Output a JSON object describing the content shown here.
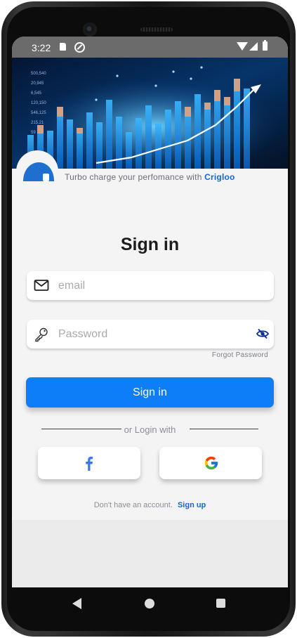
{
  "status_bar": {
    "time": "3:22",
    "icons": [
      "sd-card-icon",
      "do-not-disturb-icon",
      "wifi-icon",
      "signal-icon",
      "battery-icon"
    ]
  },
  "header": {
    "tagline_prefix": "Turbo charge your perfomance with",
    "brand_name": "Crigloo",
    "hero_numbers": [
      "500,540",
      "20,945",
      "6,545",
      "120,150",
      "546,125",
      "215,21",
      "59"
    ]
  },
  "form": {
    "title": "Sign in",
    "email_placeholder": "email",
    "email_value": "",
    "password_placeholder": "Password",
    "password_value": "",
    "forgot_password": "Forgot Password",
    "submit_label": "Sign in",
    "social_divider": "or Login with",
    "signup_prompt": "Don't have an account.",
    "signup_link": "Sign up"
  },
  "colors": {
    "primary": "#0d7ef7",
    "brand": "#1565d8",
    "logo": "#1f6fd0",
    "eye_icon": "#0d2f8f"
  },
  "icons": {
    "email": "envelope-icon",
    "password": "key-icon",
    "visibility": "eye-off-icon",
    "facebook": "facebook-icon",
    "google": "google-icon"
  }
}
